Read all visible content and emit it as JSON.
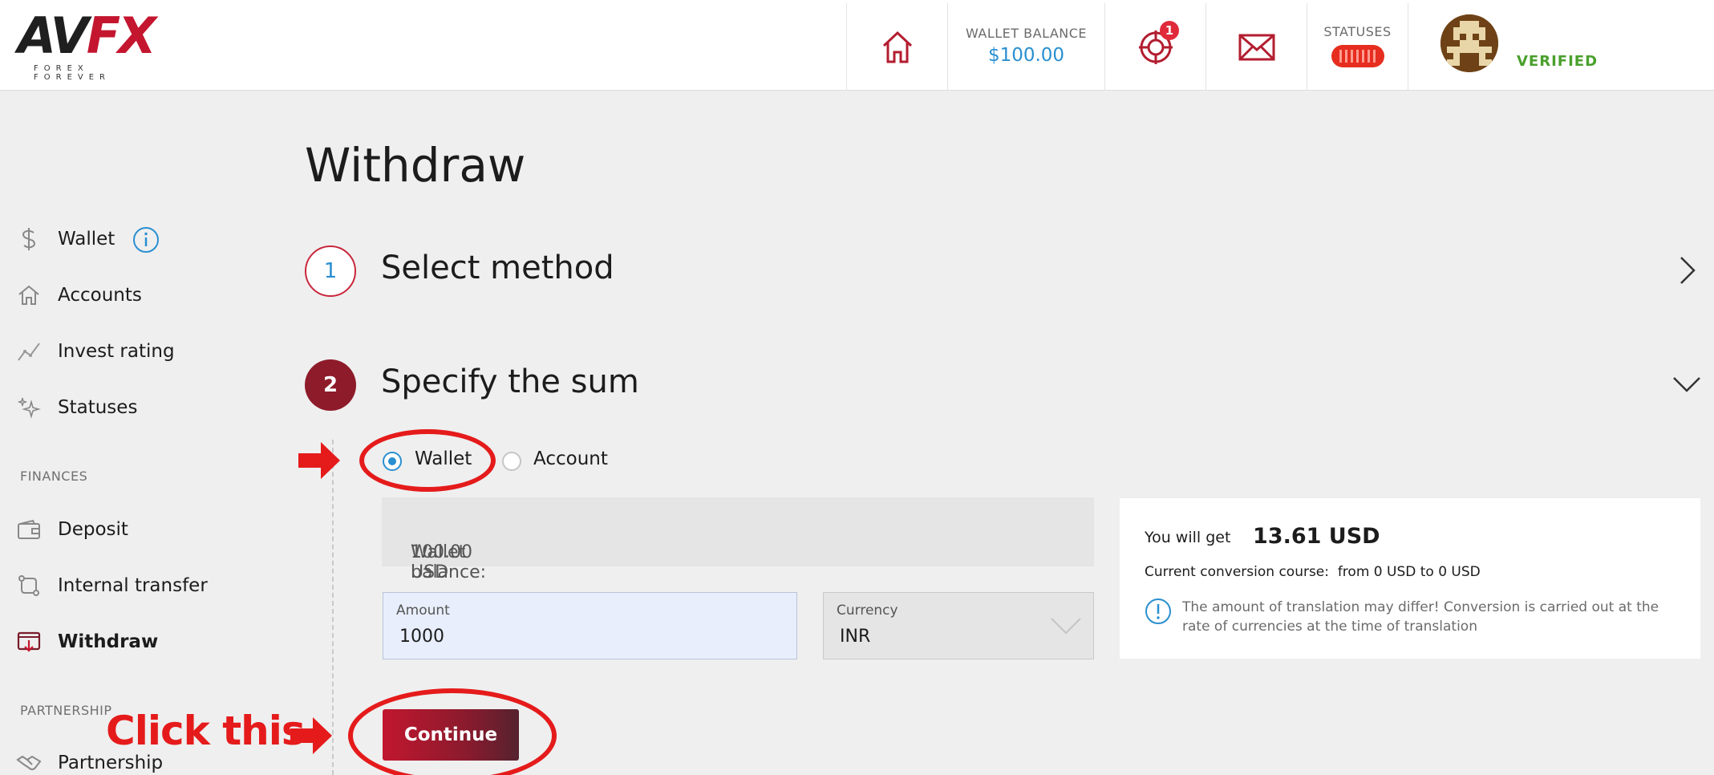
{
  "header": {
    "logo_word_a": "AV",
    "logo_word_b": "FX",
    "logo_tagline": "FOREX FOREVER",
    "home_icon": "home-icon",
    "wallet_balance_label": "WALLET BALANCE",
    "wallet_balance_value": "$100.00",
    "target_icon": "target-icon",
    "notification_count": "1",
    "mail_icon": "mail-icon",
    "statuses_label": "STATUSES",
    "verified_label": "VERIFIED"
  },
  "sidebar": {
    "items": [
      {
        "label": "Wallet",
        "icon": "dollar-icon"
      },
      {
        "label": "Accounts",
        "icon": "house-icon"
      },
      {
        "label": "Invest rating",
        "icon": "chart-line-icon"
      },
      {
        "label": "Statuses",
        "icon": "sparkle-icon"
      }
    ],
    "finances_heading": "FINANCES",
    "finances_items": [
      {
        "label": "Deposit",
        "icon": "wallet-icon"
      },
      {
        "label": "Internal transfer",
        "icon": "transfer-icon"
      },
      {
        "label": "Withdraw",
        "icon": "withdraw-icon"
      }
    ],
    "partnership_heading": "PARTNERSHIP",
    "partnership_items": [
      {
        "label": "Partnership",
        "icon": "handshake-icon"
      }
    ]
  },
  "main": {
    "page_title": "Withdraw",
    "step1": {
      "number": "1",
      "title": "Select method"
    },
    "step2": {
      "number": "2",
      "title": "Specify the sum"
    },
    "source_options": [
      "Wallet",
      "Account"
    ],
    "selected_source": "Wallet",
    "wallet_balance_label": "Wallet balance:",
    "wallet_balance_value": "100.00 USD",
    "amount_label": "Amount",
    "amount_value": "1000",
    "currency_label": "Currency",
    "currency_value": "INR",
    "continue_label": "Continue"
  },
  "info_panel": {
    "you_will_get_label": "You will get",
    "you_will_get_value": "13.61 USD",
    "course_label": "Current conversion course:",
    "course_value": "from 0 USD to 0 USD",
    "note": "The amount of translation may differ! Conversion is carried out at the rate of currencies at the time of translation"
  },
  "annotation": {
    "click_text": "Click this"
  },
  "colors": {
    "accent_red": "#c4162f",
    "link_blue": "#2a8fd0",
    "verified_green": "#4aa02c",
    "annotation_red": "#e51b1b"
  }
}
